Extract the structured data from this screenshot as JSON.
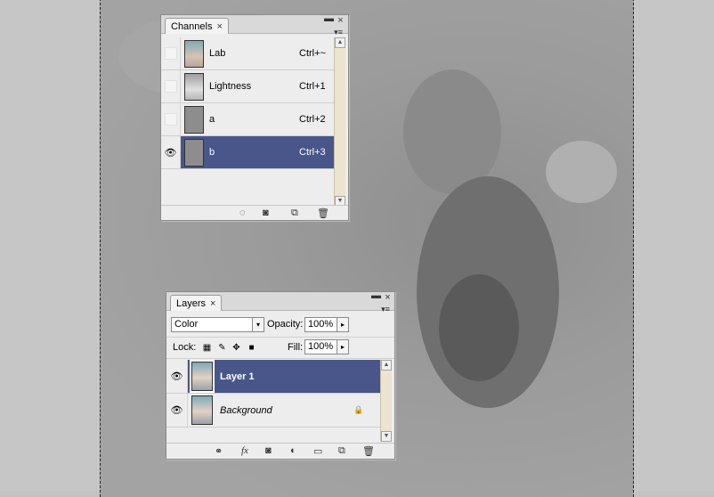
{
  "channels_panel": {
    "tab_label": "Channels",
    "minimize_glyph": "▬",
    "close_glyph": "×",
    "tab_close_glyph": "×",
    "menu_glyph": "▾≡",
    "channels": [
      {
        "name": "Lab",
        "shortcut": "Ctrl+~",
        "visible": false,
        "selected": false
      },
      {
        "name": "Lightness",
        "shortcut": "Ctrl+1",
        "visible": false,
        "selected": false
      },
      {
        "name": "a",
        "shortcut": "Ctrl+2",
        "visible": false,
        "selected": false
      },
      {
        "name": "b",
        "shortcut": "Ctrl+3",
        "visible": true,
        "selected": true
      }
    ],
    "footer_icons": [
      "load-selection-icon",
      "save-selection-icon",
      "new-channel-icon",
      "delete-channel-icon"
    ]
  },
  "layers_panel": {
    "tab_label": "Layers",
    "close_glyph": "×",
    "tab_close_glyph": "×",
    "minimize_glyph": "▬",
    "menu_glyph": "▾≡",
    "blend_mode": "Color",
    "opacity_label": "Opacity:",
    "opacity_value": "100%",
    "lock_label": "Lock:",
    "fill_label": "Fill:",
    "fill_value": "100%",
    "layers": [
      {
        "name": "Layer 1",
        "visible": true,
        "selected": true,
        "italic": false,
        "locked": false
      },
      {
        "name": "Background",
        "visible": true,
        "selected": false,
        "italic": true,
        "locked": true
      }
    ],
    "footer_icons": [
      "link-layers-icon",
      "fx-icon",
      "add-mask-icon",
      "adjustment-layer-icon",
      "new-group-icon",
      "new-layer-icon",
      "delete-layer-icon"
    ]
  },
  "icons": {
    "eye": "👁",
    "lock": "🔒",
    "stepper_arrow": "▸",
    "dropdown_arrow": "▾",
    "scroll_up": "▲",
    "scroll_down": "▼"
  }
}
